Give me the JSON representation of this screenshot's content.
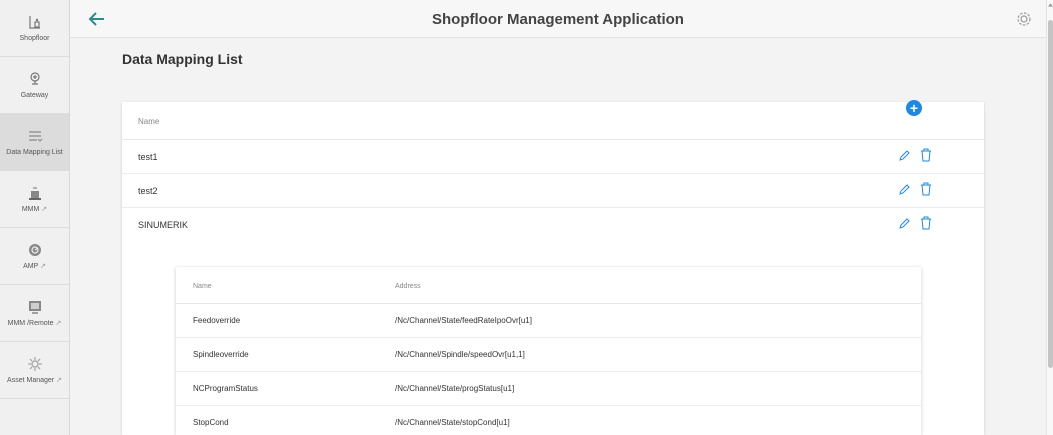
{
  "header": {
    "title": "Shopfloor Management Application"
  },
  "sidebar": {
    "items": [
      {
        "label": "Shopfloor",
        "ext": ""
      },
      {
        "label": "Gateway",
        "ext": ""
      },
      {
        "label": "Data Mapping List",
        "ext": ""
      },
      {
        "label": "MMM",
        "ext": "↗"
      },
      {
        "label": "AMP",
        "ext": "↗"
      },
      {
        "label": "MMM /Remote",
        "ext": "↗"
      },
      {
        "label": "Asset Manager",
        "ext": "↗"
      }
    ]
  },
  "main": {
    "page_title": "Data Mapping List",
    "add_label": "+",
    "table": {
      "header_name": "Name",
      "rows": [
        {
          "name": "test1"
        },
        {
          "name": "test2"
        },
        {
          "name": "SINUMERIK"
        }
      ]
    },
    "subtable": {
      "header_name": "Name",
      "header_address": "Address",
      "rows": [
        {
          "name": "Feedoverride",
          "address": "/Nc/Channel/State/feedRateIpoOvr[u1]"
        },
        {
          "name": "Spindleoverride",
          "address": "/Nc/Channel/Spindle/speedOvr[u1,1]"
        },
        {
          "name": "NCProgramStatus",
          "address": "/Nc/Channel/State/progStatus[u1]"
        },
        {
          "name": "StopCond",
          "address": "/Nc/Channel/State/stopCond[u1]"
        }
      ]
    }
  },
  "colors": {
    "accent": "#1e88e5",
    "back_arrow": "#2a8c8c"
  },
  "icons": {
    "sidebar": [
      "shopfloor-icon",
      "gateway-icon",
      "list-icon",
      "mmm-icon",
      "amp-icon",
      "monitor-icon",
      "asset-manager-icon"
    ],
    "header": [
      "back-arrow-icon",
      "gear-icon"
    ],
    "row_actions": [
      "pencil-icon",
      "trash-icon"
    ]
  }
}
